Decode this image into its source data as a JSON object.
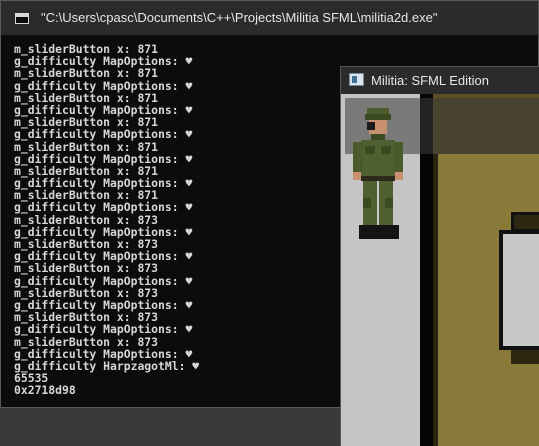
{
  "console": {
    "title": "\"C:\\Users\\cpasc\\Documents\\C++\\Projects\\Militia SFML\\militia2d.exe\"",
    "lines": [
      "m_sliderButton x: 871",
      "g_difficulty MapOptions: ♥",
      "m_sliderButton x: 871",
      "g_difficulty MapOptions: ♥",
      "m_sliderButton x: 871",
      "g_difficulty MapOptions: ♥",
      "m_sliderButton x: 871",
      "g_difficulty MapOptions: ♥",
      "m_sliderButton x: 871",
      "g_difficulty MapOptions: ♥",
      "m_sliderButton x: 871",
      "g_difficulty MapOptions: ♥",
      "m_sliderButton x: 871",
      "g_difficulty MapOptions: ♥",
      "m_sliderButton x: 873",
      "g_difficulty MapOptions: ♥",
      "m_sliderButton x: 873",
      "g_difficulty MapOptions: ♥",
      "m_sliderButton x: 873",
      "g_difficulty MapOptions: ♥",
      "m_sliderButton x: 873",
      "g_difficulty MapOptions: ♥",
      "m_sliderButton x: 873",
      "g_difficulty MapOptions: ♥",
      "m_sliderButton x: 873",
      "g_difficulty MapOptions: ♥",
      "g_difficulty HarpzagotMl: ♥",
      "65535",
      "0x2718d98"
    ]
  },
  "game_window": {
    "title": "Militia: SFML Edition",
    "icon": "app-window-icon"
  },
  "colors": {
    "console_bg": "#0c0c0c",
    "console_text": "#d7d7d7",
    "titlebar": "#2b2b2b",
    "floor": "#8a7a3a",
    "wall": "#c5c5c5"
  }
}
